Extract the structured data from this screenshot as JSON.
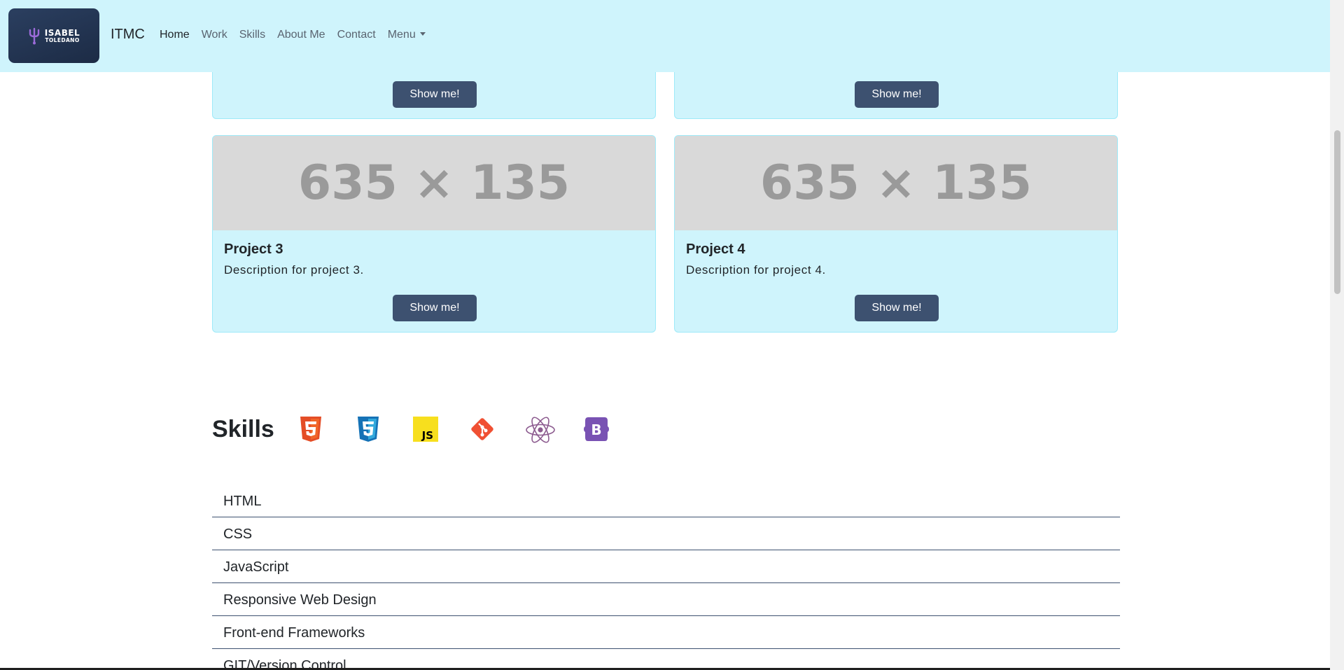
{
  "navbar": {
    "logo": {
      "line1": "ISABEL",
      "line2": "TOLEDANO"
    },
    "brand": "ITMC",
    "links": [
      {
        "label": "Home"
      },
      {
        "label": "Work"
      },
      {
        "label": "Skills"
      },
      {
        "label": "About Me"
      },
      {
        "label": "Contact"
      },
      {
        "label": "Menu"
      }
    ]
  },
  "projects": [
    {
      "button": "Show me!"
    },
    {
      "button": "Show me!"
    },
    {
      "image_label": "635 × 135",
      "title": "Project 3",
      "description": "Description for project 3.",
      "button": "Show me!"
    },
    {
      "image_label": "635 × 135",
      "title": "Project 4",
      "description": "Description for project 4.",
      "button": "Show me!"
    }
  ],
  "skills": {
    "title": "Skills",
    "icons": [
      "html5-icon",
      "css3-icon",
      "javascript-icon",
      "git-icon",
      "react-icon",
      "bootstrap-icon"
    ],
    "items": [
      "HTML",
      "CSS",
      "JavaScript",
      "Responsive Web Design",
      "Front-end Frameworks",
      "GIT/Version Control"
    ]
  },
  "colors": {
    "nav_bg": "#cff4fc",
    "card_bg": "#cff4fc",
    "button_bg": "#3d5170",
    "logo_bg": "#1c2b45"
  }
}
